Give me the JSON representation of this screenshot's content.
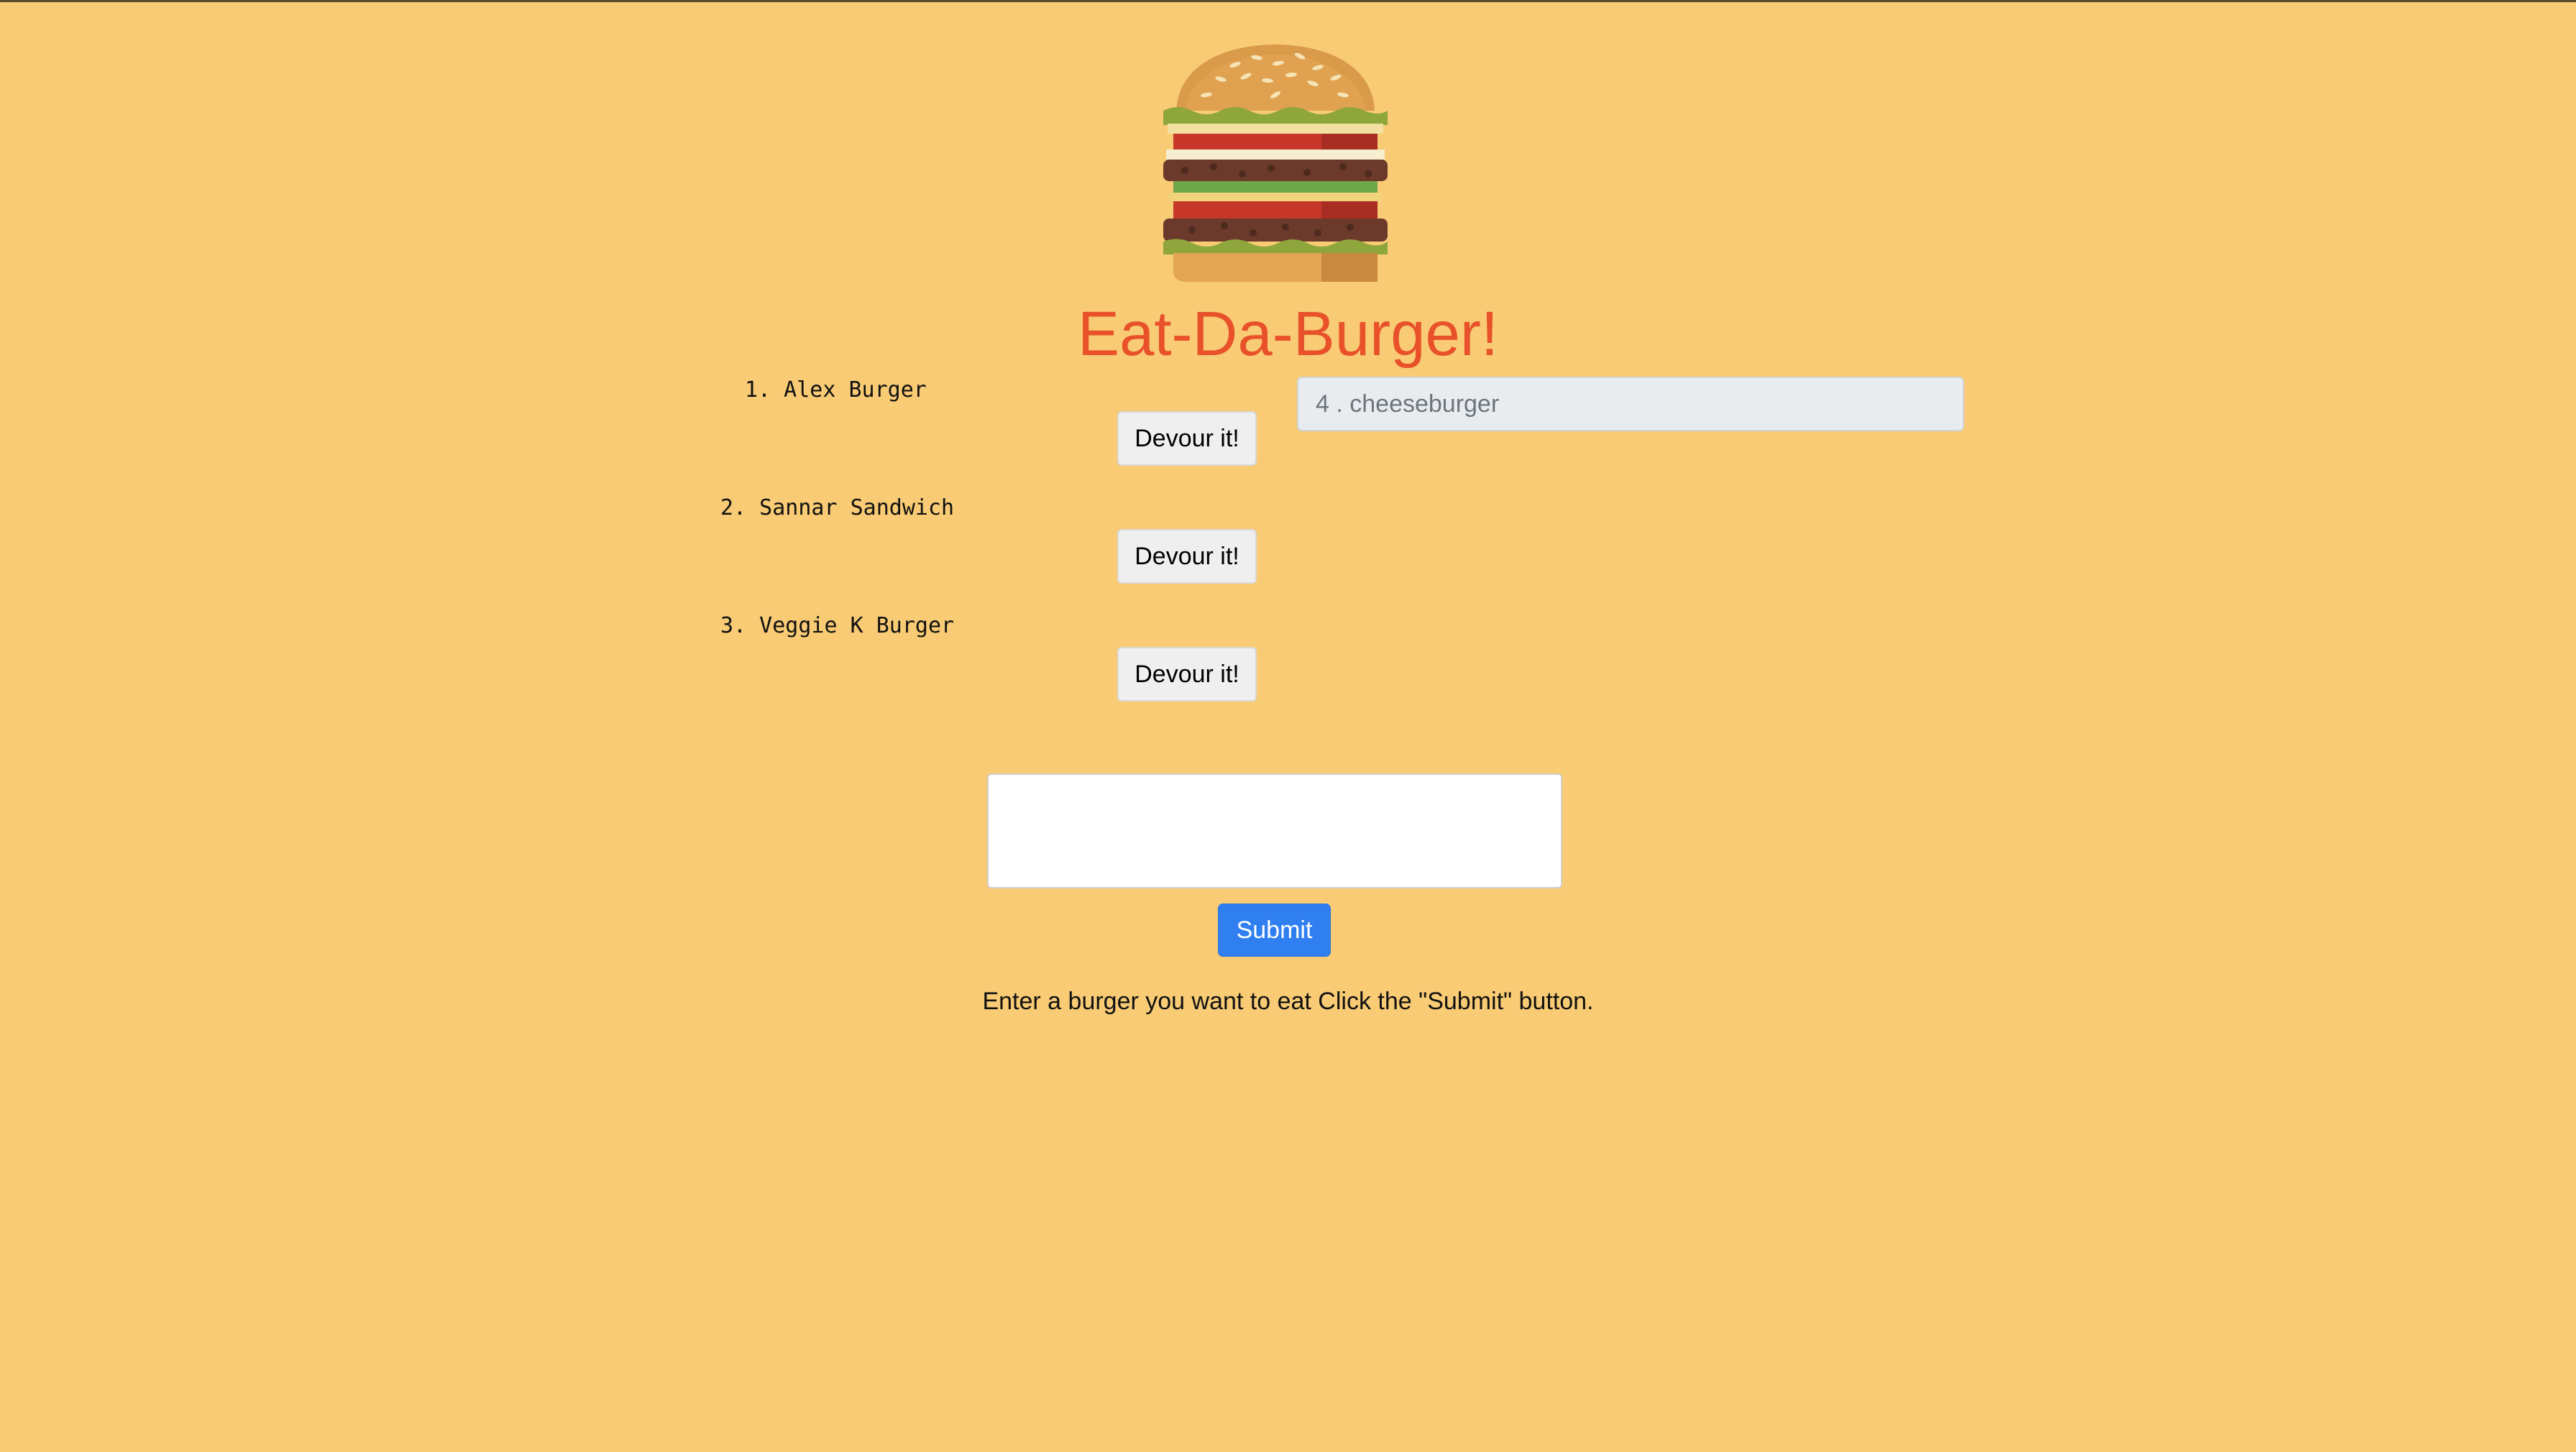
{
  "header": {
    "title": "Eat-Da-Burger!",
    "logo_icon": "burger-icon"
  },
  "burgers": [
    {
      "label": "1. Alex Burger",
      "button_label": "Devour it!"
    },
    {
      "label": "2. Sannar Sandwich",
      "button_label": "Devour it!"
    },
    {
      "label": "3. Veggie K Burger",
      "button_label": "Devour it!"
    }
  ],
  "devoured": {
    "items": [
      "4 . cheeseburger"
    ]
  },
  "form": {
    "burger_input_value": "",
    "submit_label": "Submit",
    "instructions": "Enter a burger you want to eat Click the \"Submit\" button."
  },
  "colors": {
    "background": "#f8cb74",
    "title": "#e8512a",
    "submit": "#2f7ff0",
    "devoured_field": "#e9ecef"
  }
}
